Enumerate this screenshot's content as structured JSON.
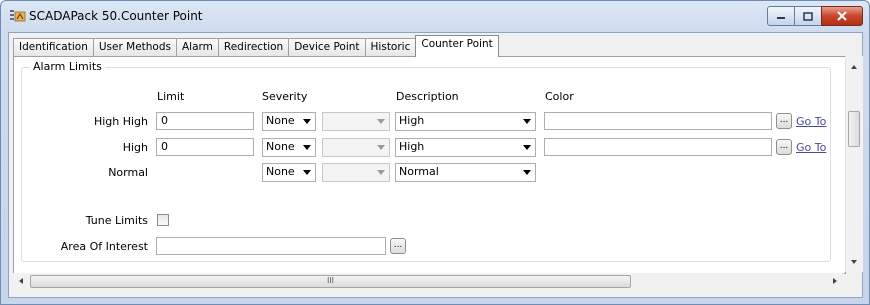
{
  "window": {
    "title": "SCADAPack 50.Counter Point",
    "icon": "scada-point-icon",
    "buttons": [
      "minimize-icon",
      "maximize-icon",
      "close-icon"
    ]
  },
  "tabs": [
    {
      "label": "Identification",
      "active": false
    },
    {
      "label": "User Methods",
      "active": false
    },
    {
      "label": "Alarm",
      "active": false
    },
    {
      "label": "Redirection",
      "active": false
    },
    {
      "label": "Device Point",
      "active": false
    },
    {
      "label": "Historic",
      "active": false
    },
    {
      "label": "Counter Point",
      "active": true
    }
  ],
  "alarm_limits": {
    "group_title": "Alarm Limits",
    "headers": {
      "limit": "Limit",
      "severity": "Severity",
      "description": "Description",
      "color": "Color"
    },
    "rows": [
      {
        "label": "High High",
        "limit": "0",
        "severity": "None",
        "secondary": "",
        "description": "High",
        "color": "",
        "ellipsis": "...",
        "goto": "Go To"
      },
      {
        "label": "High",
        "limit": "0",
        "severity": "None",
        "secondary": "",
        "description": "High",
        "color": "",
        "ellipsis": "...",
        "goto": "Go To"
      },
      {
        "label": "Normal",
        "severity": "None",
        "secondary": "",
        "description": "Normal"
      }
    ],
    "tune_limits": {
      "label": "Tune Limits",
      "checked": false
    },
    "area_of_interest": {
      "label": "Area Of Interest",
      "value": "",
      "ellipsis": "..."
    }
  },
  "scrollbars": {
    "h_thumb_grip": "III"
  }
}
